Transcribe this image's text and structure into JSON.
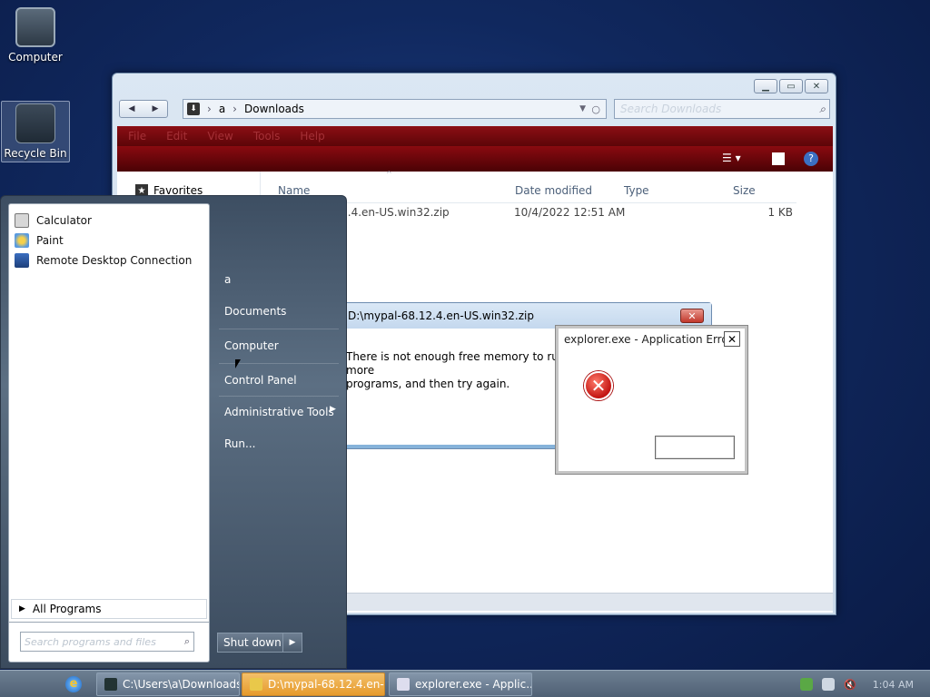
{
  "desktop": {
    "icons": [
      {
        "label": "Computer"
      },
      {
        "label": "Recycle Bin"
      }
    ]
  },
  "explorer": {
    "breadcrumb": [
      "a",
      "Downloads"
    ],
    "search_placeholder": "Search Downloads",
    "menu": [
      "File",
      "Edit",
      "View",
      "Tools",
      "Help"
    ],
    "nav_favorites": "Favorites",
    "columns": {
      "name": "Name",
      "date": "Date modified",
      "type": "Type",
      "size": "Size"
    },
    "rows": [
      {
        "name": "mypal-68.12.4.en-US.win32.zip",
        "date": "10/4/2022 12:51 AM",
        "type": "",
        "size": "1 KB"
      }
    ]
  },
  "zip_dialog": {
    "title": "D:\\mypal-68.12.4.en-US.win32.zip",
    "message_line1": "There is not enough free memory to run this program. Quit one or more",
    "message_line2": "programs, and then try again."
  },
  "error_dialog": {
    "title": "explorer.exe - Application Error",
    "close_label": "✕",
    "ok_label": ""
  },
  "start_menu": {
    "programs": [
      {
        "label": "Calculator"
      },
      {
        "label": "Paint"
      },
      {
        "label": "Remote Desktop Connection"
      }
    ],
    "all_programs": "All Programs",
    "search_placeholder": "Search programs and files",
    "right_items": {
      "user": "a",
      "documents": "Documents",
      "computer": "Computer",
      "control_panel": "Control Panel",
      "admin_tools": "Administrative Tools",
      "run": "Run..."
    },
    "shutdown": "Shut down"
  },
  "taskbar": {
    "buttons": [
      {
        "label": "C:\\Users\\a\\Downloads"
      },
      {
        "label": "D:\\mypal-68.12.4.en-..."
      },
      {
        "label": "explorer.exe - Applic..."
      }
    ],
    "clock": "1:04 AM"
  }
}
